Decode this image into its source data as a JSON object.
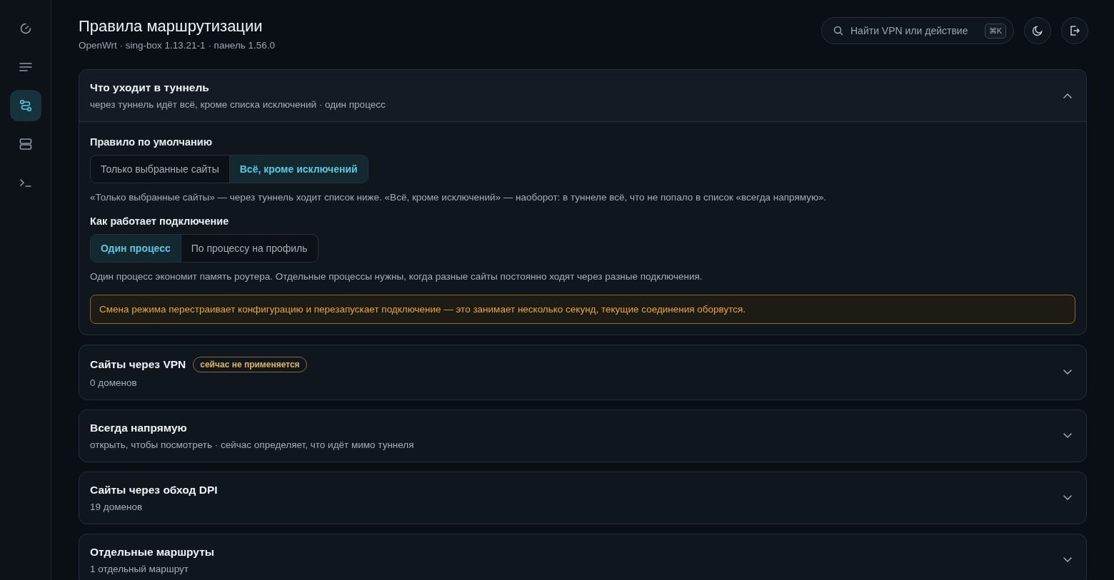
{
  "sidebar": {
    "items": [
      {
        "kind": "gauge",
        "selected": false
      },
      {
        "kind": "list",
        "selected": false
      },
      {
        "kind": "route",
        "selected": true
      },
      {
        "kind": "server",
        "selected": false
      },
      {
        "kind": "terminal",
        "selected": false
      }
    ]
  },
  "header": {
    "title": "Правила маршрутизации",
    "subtitle": "OpenWrt · sing-box 1.13.21-1 · панель 1.56.0",
    "search": {
      "placeholder": "Найти VPN или действие",
      "shortcut": "⌘K"
    }
  },
  "sections": [
    {
      "title": "Что уходит в туннель",
      "subtitle": "через туннель идёт всё, кроме списка исключений · один процесс",
      "expanded": true,
      "groups": [
        {
          "label": "Правило по умолчанию",
          "options": [
            {
              "label": "Только выбранные сайты",
              "selected": false
            },
            {
              "label": "Всё, кроме исключений",
              "selected": true
            }
          ],
          "description": "«Только выбранные сайты» — через туннель ходит список ниже. «Всё, кроме исключений» — наоборот: в туннеле всё, что не попало в список «всегда напрямую»."
        },
        {
          "label": "Как работает подключение",
          "options": [
            {
              "label": "Один процесс",
              "selected": true
            },
            {
              "label": "По процессу на профиль",
              "selected": false
            }
          ],
          "description": "Один процесс экономит память роутера. Отдельные процессы нужны, когда разные сайты постоянно ходят через разные подключения."
        }
      ],
      "warning": "Смена режима перестраивает конфигурацию и перезапускает подключение — это занимает несколько секунд, текущие соединения оборвутся."
    },
    {
      "title": "Сайты через VPN",
      "badge": "сейчас не применяется",
      "subtitle": "0 доменов",
      "expanded": false
    },
    {
      "title": "Всегда напрямую",
      "subtitle": "открыть, чтобы посмотреть · сейчас определяет, что идёт мимо туннеля",
      "expanded": false
    },
    {
      "title": "Сайты через обход DPI",
      "subtitle": "19 доменов",
      "expanded": false
    },
    {
      "title": "Отдельные маршруты",
      "subtitle": "1 отдельный маршрут",
      "expanded": false
    }
  ]
}
